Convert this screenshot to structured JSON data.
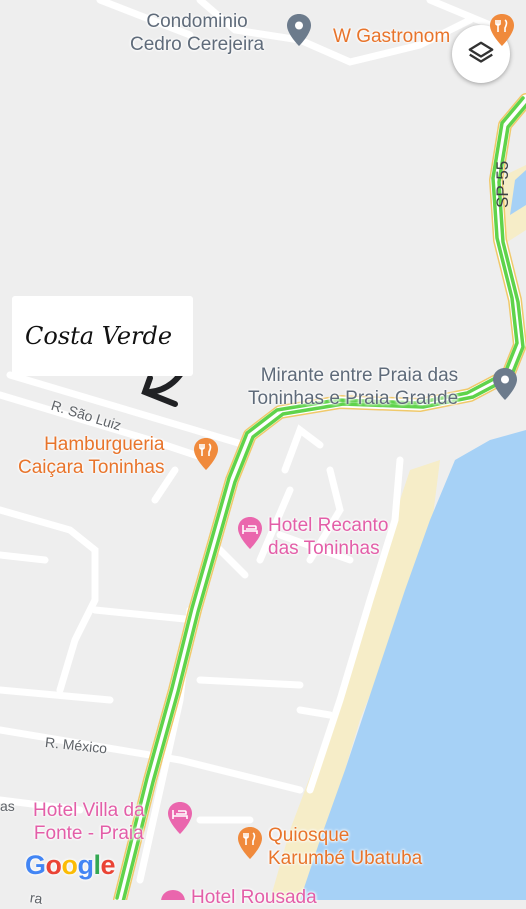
{
  "map": {
    "road_shield": "SP-55",
    "streets": [
      "R. São Luiz",
      "R. México",
      "as",
      "ra"
    ],
    "places": [
      {
        "lines": [
          "Condominio",
          "Cedro Cerejeira"
        ],
        "icon": "pin-icon",
        "color": "#5f6b7a"
      },
      {
        "lines": [
          "W Gastronom"
        ],
        "icon": "restaurant-icon",
        "color": "#e8742b"
      },
      {
        "lines": [
          "Mirante entre Praia das",
          "Toninhas e Praia Grande"
        ],
        "icon": "pin-icon",
        "color": "#5f6b7a"
      },
      {
        "lines": [
          "Hamburgueria",
          "Caiçara Toninhas"
        ],
        "icon": "restaurant-icon",
        "color": "#e8742b"
      },
      {
        "lines": [
          "Hotel Recanto",
          "das Toninhas"
        ],
        "icon": "hotel-icon",
        "color": "#e35ea8"
      },
      {
        "lines": [
          "Hotel Villa da",
          "Fonte - Praia"
        ],
        "icon": "hotel-icon",
        "color": "#e35ea8"
      },
      {
        "lines": [
          "Quiosque",
          "Karumbé Ubatuba"
        ],
        "icon": "restaurant-icon",
        "color": "#e8742b"
      },
      {
        "lines": [
          "Hotel Rousada"
        ],
        "icon": "hotel-icon",
        "color": "#e35ea8"
      }
    ],
    "annotation": "Costa Verde",
    "logo": [
      "G",
      "o",
      "o",
      "g",
      "l",
      "e"
    ],
    "colors": {
      "land": "#eeeeee",
      "water": "#a6d1f6",
      "beach": "#f6edc8",
      "road": "#ffffff",
      "traffic": "#5fd34b",
      "highway_edge": "#f0c96a",
      "logo": [
        "#4285F4",
        "#EA4335",
        "#FBBC05",
        "#4285F4",
        "#34A853",
        "#EA4335"
      ]
    },
    "layers_icon": "layers-icon"
  }
}
